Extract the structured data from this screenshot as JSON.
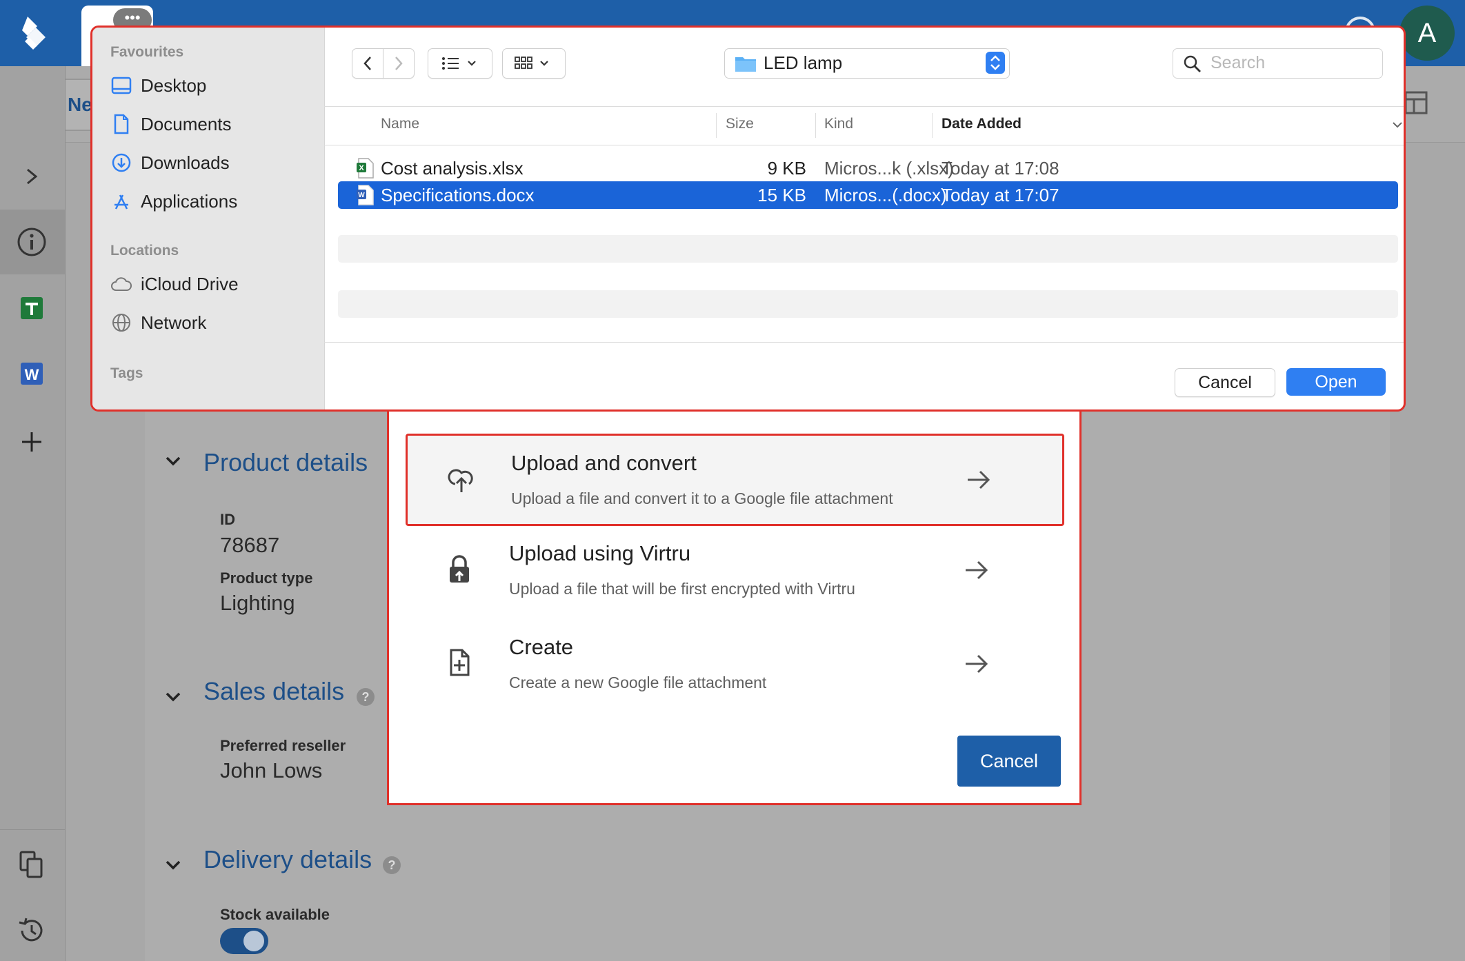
{
  "app": {
    "tab_dots": "•••",
    "avatar_initial": "A",
    "new_button_label": "Ne"
  },
  "sections": {
    "product": {
      "title": "Product details",
      "id_label": "ID",
      "id_value": "78687",
      "type_label": "Product type",
      "type_value": "Lighting"
    },
    "sales": {
      "title": "Sales details",
      "help": "?",
      "reseller_label": "Preferred reseller",
      "reseller_value": "John Lows"
    },
    "delivery": {
      "title": "Delivery details",
      "help": "?",
      "stock_label": "Stock available",
      "stock_on": true
    }
  },
  "upload_dialog": {
    "options": [
      {
        "title": "Upload and convert",
        "description": "Upload a file and convert it to a Google file attachment",
        "icon": "cloud-upload-icon"
      },
      {
        "title": "Upload using Virtru",
        "description": "Upload a file that will be first encrypted with Virtru",
        "icon": "lock-upload-icon"
      },
      {
        "title": "Create",
        "description": "Create a new Google file attachment",
        "icon": "new-file-icon"
      }
    ],
    "cancel_label": "Cancel"
  },
  "file_dialog": {
    "sidebar": {
      "favourites_heading": "Favourites",
      "favourites": [
        {
          "label": "Desktop",
          "icon": "desktop-icon"
        },
        {
          "label": "Documents",
          "icon": "document-icon"
        },
        {
          "label": "Downloads",
          "icon": "downloads-icon"
        },
        {
          "label": "Applications",
          "icon": "applications-icon"
        }
      ],
      "locations_heading": "Locations",
      "locations": [
        {
          "label": "iCloud Drive",
          "icon": "cloud-icon"
        },
        {
          "label": "Network",
          "icon": "globe-icon"
        }
      ],
      "tags_heading": "Tags"
    },
    "current_folder": "LED lamp",
    "search_placeholder": "Search",
    "columns": {
      "name": "Name",
      "size": "Size",
      "kind": "Kind",
      "date": "Date Added"
    },
    "files": [
      {
        "name": "Cost analysis.xlsx",
        "size": "9 KB",
        "kind": "Micros...k (.xlsx)",
        "date": "Today at 17:08",
        "type": "excel",
        "selected": false
      },
      {
        "name": "Specifications.docx",
        "size": "15 KB",
        "kind": "Micros...(.docx)",
        "date": "Today at 17:07",
        "type": "word",
        "selected": true
      }
    ],
    "cancel_label": "Cancel",
    "open_label": "Open"
  },
  "colors": {
    "brand_blue": "#1e5fa8",
    "highlight_red": "#e0302a",
    "mac_blue": "#2f7ff2",
    "selection_blue": "#1a64d8"
  }
}
